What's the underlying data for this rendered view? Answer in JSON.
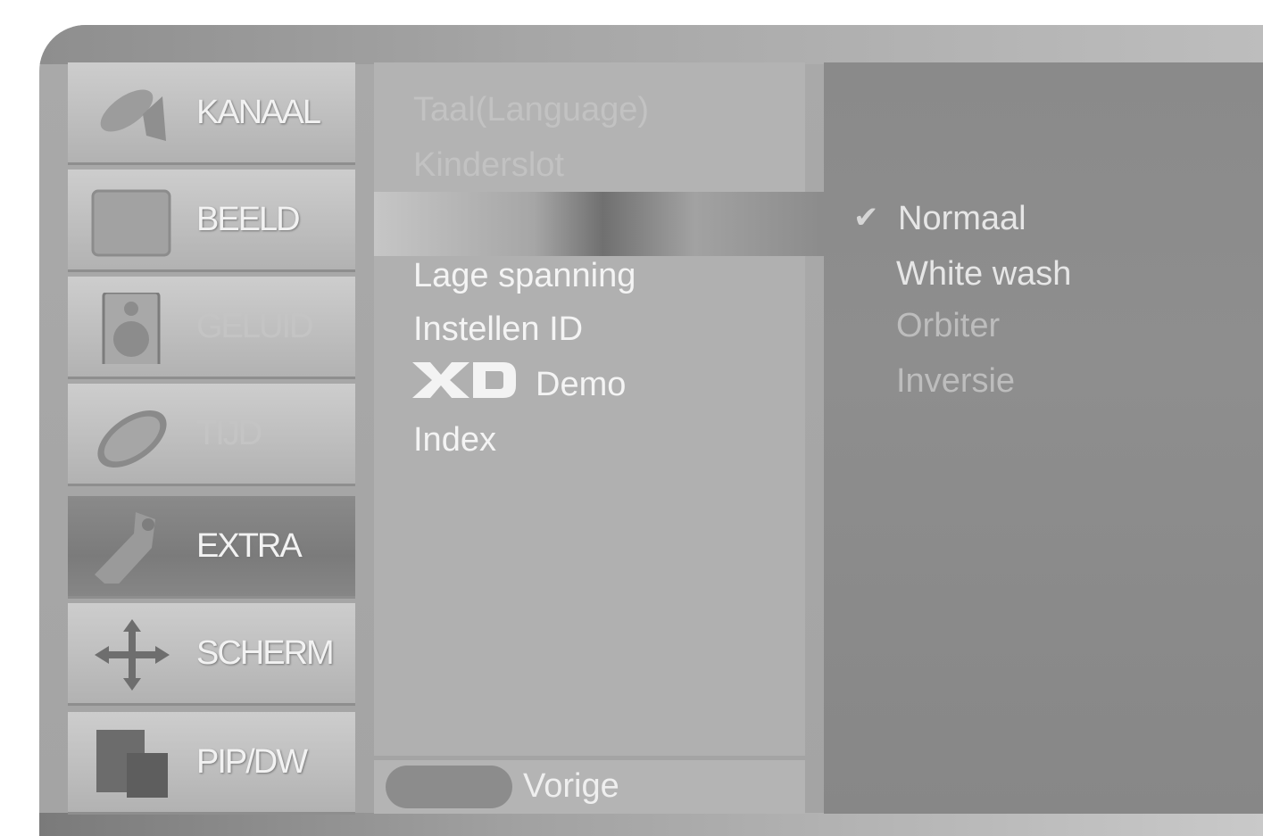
{
  "sidebar": {
    "items": [
      {
        "label": "KANAAL",
        "icon": "satellite-dish-icon"
      },
      {
        "label": "BEELD",
        "icon": "picture-icon"
      },
      {
        "label": "GELUID",
        "icon": "speaker-icon"
      },
      {
        "label": "TIJD",
        "icon": "clock-icon"
      },
      {
        "label": "EXTRA",
        "icon": "tag-icon",
        "active": true
      },
      {
        "label": "SCHERM",
        "icon": "move-arrows-icon"
      },
      {
        "label": "PIP/DW",
        "icon": "pip-icon"
      }
    ]
  },
  "menu": {
    "items": [
      {
        "label": "Taal(Language)"
      },
      {
        "label": "Kinderslot"
      },
      {
        "label": ""
      },
      {
        "label": "Lage spanning"
      },
      {
        "label": "Instellen ID"
      },
      {
        "label": "Demo",
        "logo": "XD"
      },
      {
        "label": "Index"
      }
    ],
    "back_label": "Vorige"
  },
  "options": {
    "items": [
      {
        "label": "Normaal",
        "selected": true
      },
      {
        "label": "White wash"
      },
      {
        "label": "Orbiter"
      },
      {
        "label": "Inversie"
      }
    ]
  }
}
